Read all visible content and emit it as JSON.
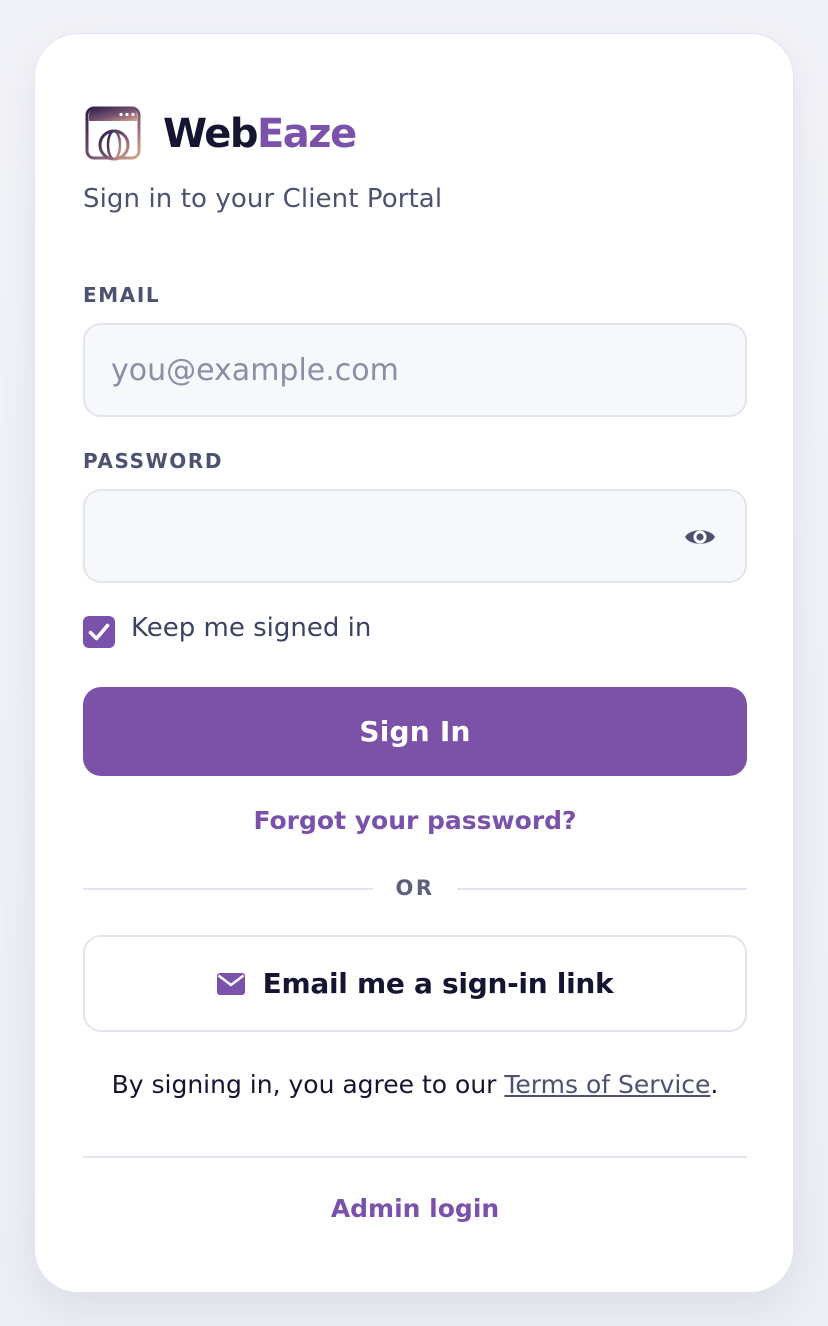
{
  "brand": {
    "name_part1": "Web",
    "name_part2": "Eaze",
    "logo_icon": "browser-globe-icon",
    "accent_color": "#7b52ab"
  },
  "subtitle": "Sign in to your Client Portal",
  "email": {
    "label": "EMAIL",
    "placeholder": "you@example.com",
    "value": ""
  },
  "password": {
    "label": "PASSWORD",
    "value": "",
    "toggle_icon": "eye-icon"
  },
  "remember": {
    "label": "Keep me signed in",
    "checked": true
  },
  "sign_in_button": "Sign In",
  "forgot_link": "Forgot your password?",
  "divider_text": "OR",
  "magic_link": {
    "icon": "envelope-icon",
    "label": "Email me a sign-in link"
  },
  "terms": {
    "prefix": "By signing in, you agree to our ",
    "link": "Terms of Service",
    "suffix": "."
  },
  "admin_link": "Admin login"
}
